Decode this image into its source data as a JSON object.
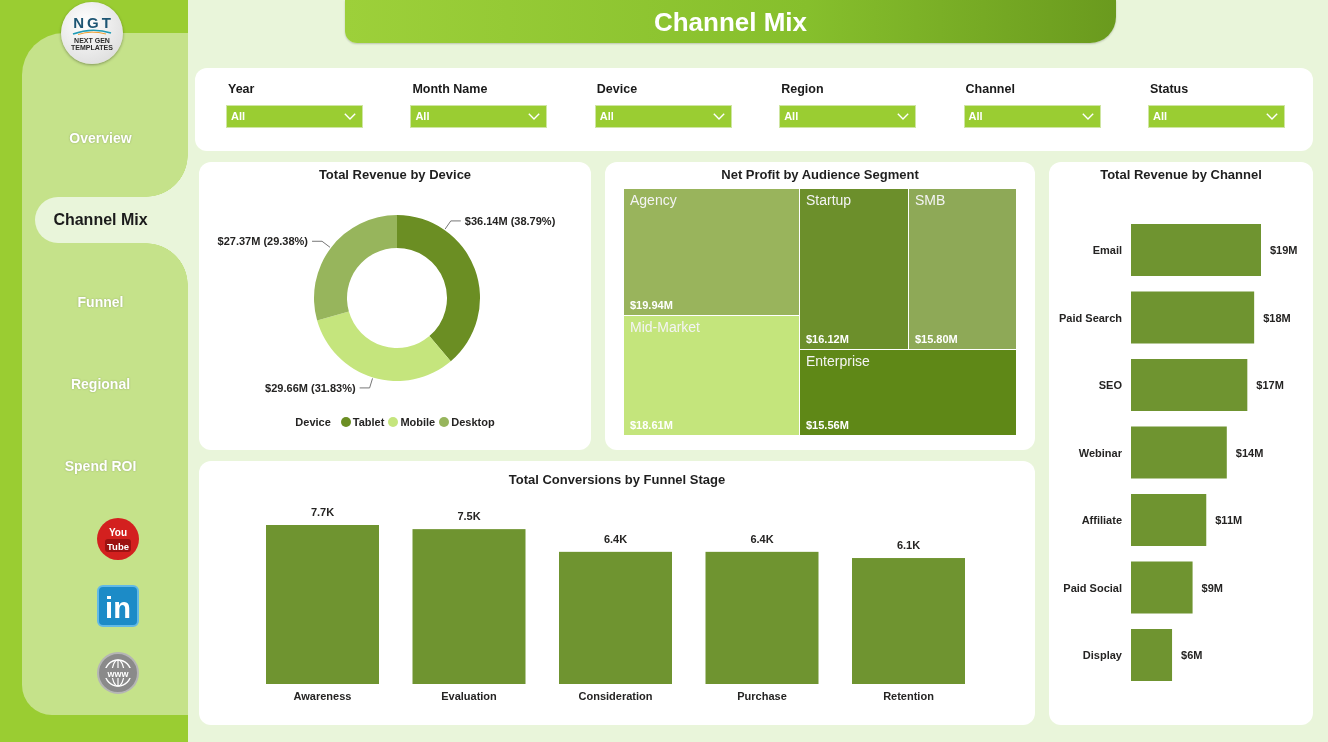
{
  "sidebar": {
    "logo": {
      "mark": "NGT",
      "tagline": "NEXT GEN TEMPLATES"
    },
    "nav": [
      {
        "label": "Overview",
        "selected": false
      },
      {
        "label": "Channel Mix",
        "selected": true
      },
      {
        "label": "Funnel",
        "selected": false
      },
      {
        "label": "Regional",
        "selected": false
      },
      {
        "label": "Spend ROI",
        "selected": false
      }
    ],
    "links": [
      {
        "kind": "video",
        "lines": [
          "You",
          "Tube"
        ]
      },
      {
        "kind": "network",
        "lines": [
          "in"
        ]
      },
      {
        "kind": "web",
        "lines": [
          "www"
        ]
      }
    ]
  },
  "header": {
    "title": "Channel Mix"
  },
  "filters": [
    {
      "label": "Year",
      "value": "All"
    },
    {
      "label": "Month Name",
      "value": "All"
    },
    {
      "label": "Device",
      "value": "All"
    },
    {
      "label": "Region",
      "value": "All"
    },
    {
      "label": "Channel",
      "value": "All"
    },
    {
      "label": "Status",
      "value": "All"
    }
  ],
  "device_chart": {
    "chart_data": {
      "type": "donut",
      "title": "Total Revenue by Device",
      "categories": [
        "Tablet",
        "Mobile",
        "Desktop"
      ],
      "values": [
        38.79,
        31.83,
        29.38
      ],
      "value_labels": [
        "$36.14M (38.79%)",
        "$29.66M (31.83%)",
        "$27.37M (29.38%)"
      ],
      "colors": [
        "#6b8e23",
        "#c5e57d",
        "#97b55c"
      ],
      "legend": {
        "title": "Device"
      }
    }
  },
  "treemap": {
    "title": "Net Profit by Audience Segment",
    "tiles": [
      {
        "segment": "Agency",
        "net_profit": "$19.94M",
        "color": "#99b45c"
      },
      {
        "segment": "Mid-Market",
        "net_profit": "$18.61M",
        "color": "#c4e57c"
      },
      {
        "segment": "Startup",
        "net_profit": "$16.12M",
        "color": "#6c8f2b"
      },
      {
        "segment": "SMB",
        "net_profit": "$15.80M",
        "color": "#8ea957"
      },
      {
        "segment": "Enterprise",
        "net_profit": "$15.56M",
        "color": "#5f8817"
      }
    ]
  },
  "channel_chart": {
    "chart_data": {
      "type": "bar",
      "orientation": "horizontal",
      "title": "Total Revenue by Channel",
      "categories": [
        "Email",
        "Paid Search",
        "SEO",
        "Webinar",
        "Affiliate",
        "Paid Social",
        "Display"
      ],
      "values": [
        19,
        18,
        17,
        14,
        11,
        9,
        6
      ],
      "value_labels": [
        "$19M",
        "$18M",
        "$17M",
        "$14M",
        "$11M",
        "$9M",
        "$6M"
      ]
    }
  },
  "funnel_chart": {
    "chart_data": {
      "type": "bar",
      "orientation": "vertical",
      "title": "Total Conversions by Funnel Stage",
      "categories": [
        "Awareness",
        "Evaluation",
        "Consideration",
        "Purchase",
        "Retention"
      ],
      "values": [
        7.7,
        7.5,
        6.4,
        6.4,
        6.1
      ],
      "value_labels": [
        "7.7K",
        "7.5K",
        "6.4K",
        "6.4K",
        "6.1K"
      ]
    }
  }
}
